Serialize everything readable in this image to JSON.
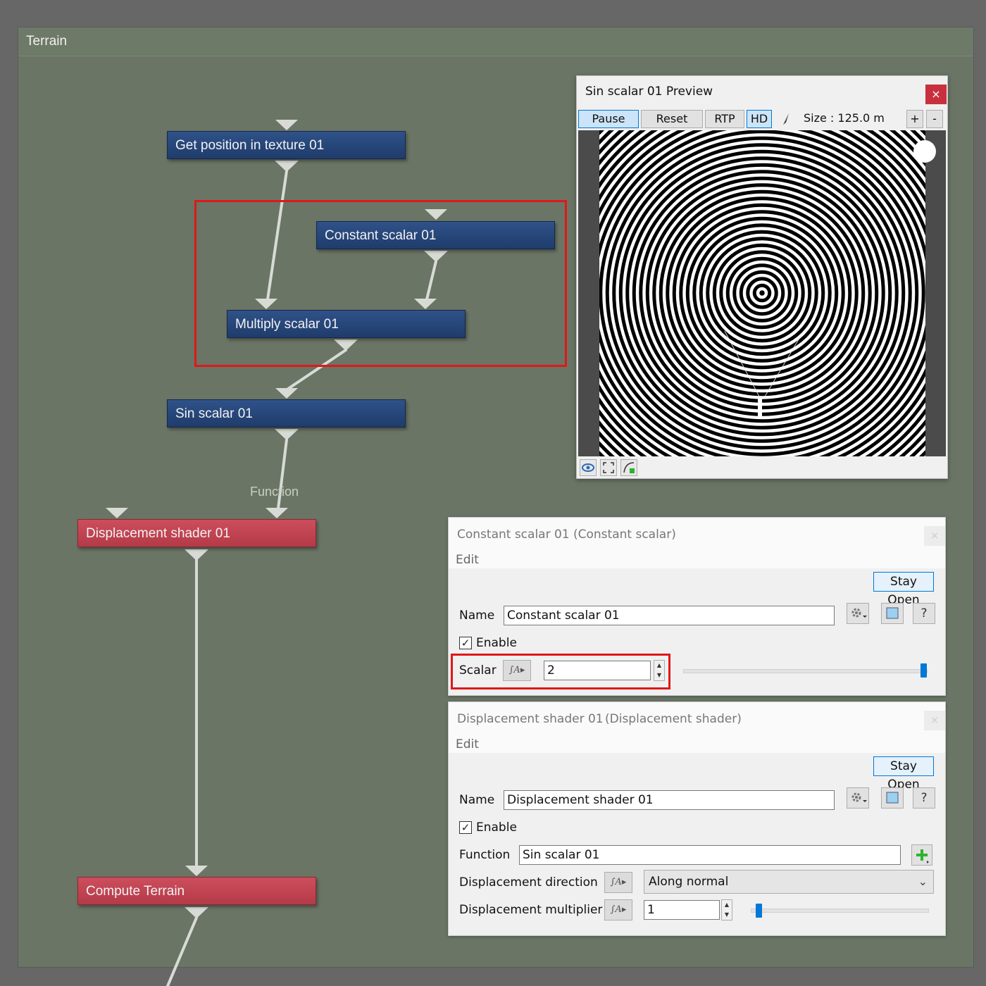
{
  "window": {
    "title": "Terrain"
  },
  "graph": {
    "nodes": {
      "get_position": "Get position in texture 01",
      "constant_scalar": "Constant scalar 01",
      "multiply_scalar": "Multiply scalar 01",
      "sin_scalar": "Sin scalar 01",
      "displacement_shader": "Displacement shader 01",
      "compute_terrain": "Compute Terrain"
    },
    "wire_label": "Function"
  },
  "preview": {
    "title": "Sin scalar 01 Preview",
    "close": "×",
    "buttons": {
      "pause": "Pause",
      "reset": "Reset",
      "rtp": "RTP",
      "hd": "HD"
    },
    "size_label": "Size : 125.0 m",
    "zoom_in": "+",
    "zoom_out": "-"
  },
  "constant_panel": {
    "title": "Constant scalar 01",
    "subtitle": "(Constant scalar)",
    "edit_label": "Edit",
    "close": "×",
    "stay_open": "Stay Open",
    "name_label": "Name",
    "name_value": "Constant scalar 01",
    "enable_label": "Enable",
    "enable_checked": true,
    "scalar_label": "Scalar",
    "scalar_value": "2",
    "help": "?"
  },
  "displacement_panel": {
    "title": "Displacement shader 01",
    "subtitle": "(Displacement shader)",
    "edit_label": "Edit",
    "close": "×",
    "stay_open": "Stay Open",
    "name_label": "Name",
    "name_value": "Displacement shader 01",
    "enable_label": "Enable",
    "enable_checked": true,
    "function_label": "Function",
    "function_value": "Sin scalar 01",
    "direction_label": "Displacement direction",
    "direction_value": "Along normal",
    "multiplier_label": "Displacement multiplier",
    "multiplier_value": "1",
    "help": "?"
  },
  "colors": {
    "node_blue": "#2a4a7e",
    "node_red": "#c4444f",
    "canvas": "#6a7565",
    "highlight": "#e01818",
    "accent": "#0078d7"
  }
}
